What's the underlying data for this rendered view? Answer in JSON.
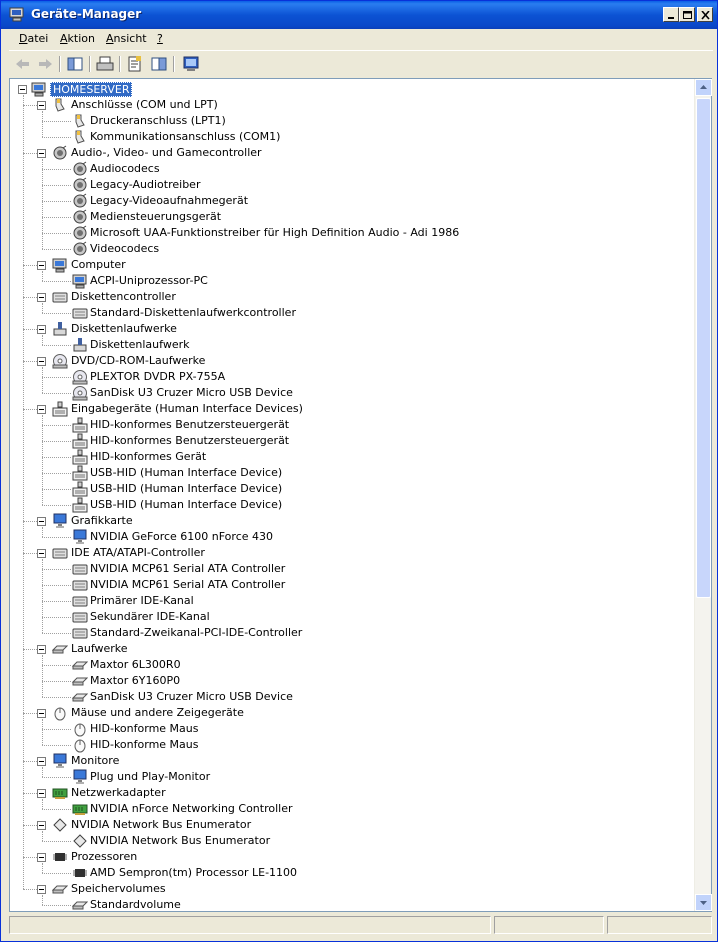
{
  "window": {
    "title": "Geräte-Manager"
  },
  "menu": [
    {
      "label": "Datei",
      "key": "D",
      "rest": "atei"
    },
    {
      "label": "Aktion",
      "key": "A",
      "rest": "ktion"
    },
    {
      "label": "Ansicht",
      "key": "A",
      "rest": "nsicht"
    },
    {
      "label": "?",
      "key": "?",
      "rest": ""
    }
  ],
  "toolbar": [
    "back-icon",
    "forward-icon",
    "console-tree-icon",
    "print-icon",
    "properties-icon",
    "help-icon",
    "scan-hardware-icon"
  ],
  "tree": {
    "root": "HOMESERVER",
    "categories": [
      {
        "label": "Anschlüsse (COM und LPT)",
        "icon": "port-icon",
        "children": [
          "Druckeranschluss (LPT1)",
          "Kommunikationsanschluss (COM1)"
        ]
      },
      {
        "label": "Audio-, Video- und Gamecontroller",
        "icon": "sound-icon",
        "children": [
          "Audiocodecs",
          "Legacy-Audiotreiber",
          "Legacy-Videoaufnahmegerät",
          "Mediensteuerungsgerät",
          "Microsoft UAA-Funktionstreiber für High Definition Audio - Adi 1986",
          "Videocodecs"
        ]
      },
      {
        "label": "Computer",
        "icon": "computer-icon",
        "children": [
          "ACPI-Uniprozessor-PC"
        ]
      },
      {
        "label": "Diskettencontroller",
        "icon": "controller-icon",
        "children": [
          "Standard-Diskettenlaufwerkcontroller"
        ]
      },
      {
        "label": "Diskettenlaufwerke",
        "icon": "floppy-icon",
        "children": [
          "Diskettenlaufwerk"
        ]
      },
      {
        "label": "DVD/CD-ROM-Laufwerke",
        "icon": "cdrom-icon",
        "children": [
          "PLEXTOR DVDR   PX-755A",
          "SanDisk U3 Cruzer Micro USB Device"
        ]
      },
      {
        "label": "Eingabegeräte (Human Interface Devices)",
        "icon": "hid-icon",
        "children": [
          "HID-konformes Benutzersteuergerät",
          "HID-konformes Benutzersteuergerät",
          "HID-konformes Gerät",
          "USB-HID (Human Interface Device)",
          "USB-HID (Human Interface Device)",
          "USB-HID (Human Interface Device)"
        ]
      },
      {
        "label": "Grafikkarte",
        "icon": "display-icon",
        "children": [
          "NVIDIA GeForce 6100 nForce 430"
        ]
      },
      {
        "label": "IDE ATA/ATAPI-Controller",
        "icon": "controller-icon",
        "children": [
          "NVIDIA MCP61 Serial ATA Controller",
          "NVIDIA MCP61 Serial ATA Controller",
          "Primärer IDE-Kanal",
          "Sekundärer IDE-Kanal",
          "Standard-Zweikanal-PCI-IDE-Controller"
        ]
      },
      {
        "label": "Laufwerke",
        "icon": "disk-icon",
        "children": [
          "Maxtor 6L300R0",
          "Maxtor 6Y160P0",
          "SanDisk U3 Cruzer Micro USB Device"
        ]
      },
      {
        "label": "Mäuse und andere Zeigegeräte",
        "icon": "mouse-icon",
        "children": [
          "HID-konforme Maus",
          "HID-konforme Maus"
        ]
      },
      {
        "label": "Monitore",
        "icon": "display-icon",
        "children": [
          "Plug und Play-Monitor"
        ]
      },
      {
        "label": "Netzwerkadapter",
        "icon": "network-icon",
        "children": [
          "NVIDIA nForce Networking Controller"
        ]
      },
      {
        "label": "NVIDIA Network Bus Enumerator",
        "icon": "bus-icon",
        "children": [
          "NVIDIA Network Bus Enumerator"
        ]
      },
      {
        "label": "Prozessoren",
        "icon": "cpu-icon",
        "children": [
          "AMD Sempron(tm) Processor LE-1100"
        ]
      },
      {
        "label": "Speichervolumes",
        "icon": "disk-icon",
        "children": [
          "Standardvolume"
        ]
      }
    ]
  },
  "colors": {
    "titlebar": "#0c53d4",
    "selection": "#316ac5",
    "frame": "#ece9d8"
  }
}
